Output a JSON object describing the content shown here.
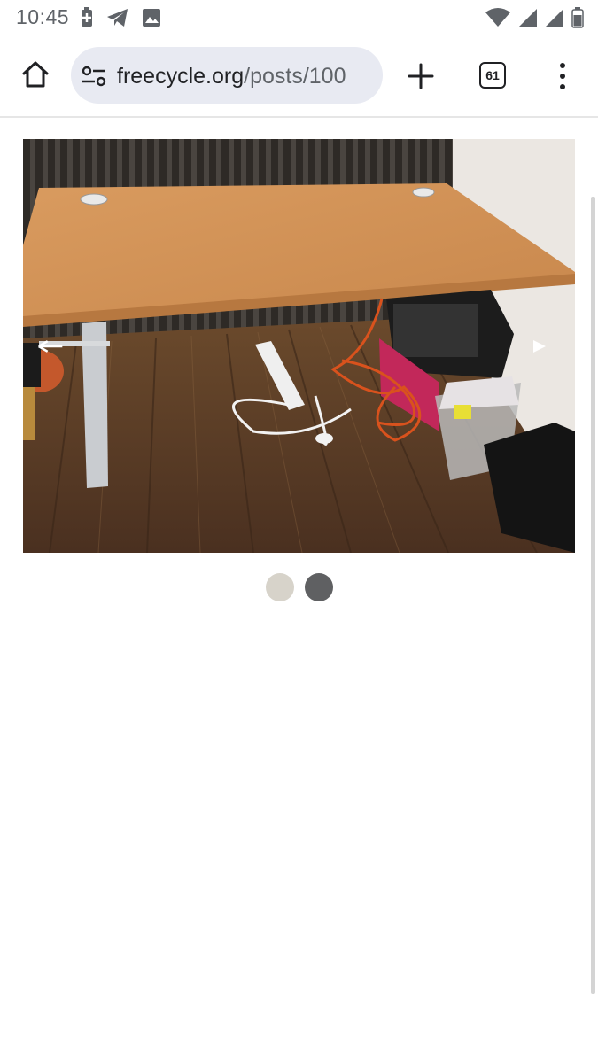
{
  "status_bar": {
    "time": "10:45",
    "left_icons": [
      "battery-saver-icon",
      "telegram-icon",
      "image-icon"
    ],
    "right_icons": [
      "wifi-icon",
      "signal-icon",
      "signal-icon",
      "battery-icon"
    ]
  },
  "browser": {
    "url_domain": "freecycle.org",
    "url_path": "/posts/100",
    "tab_count": "61",
    "icons": {
      "home": "home-icon",
      "site_settings": "site-settings-icon",
      "new_tab": "plus-icon",
      "menu": "more-vert-icon"
    }
  },
  "gallery": {
    "image_subject": "wooden office desk with white legs on a wood floor",
    "current_index": 2,
    "total": 2,
    "dot_colors": {
      "inactive": "#d7d3ca",
      "active": "#5f6062"
    },
    "prev_icon": "arrow-left-icon",
    "next_icon": "play-right-icon"
  }
}
